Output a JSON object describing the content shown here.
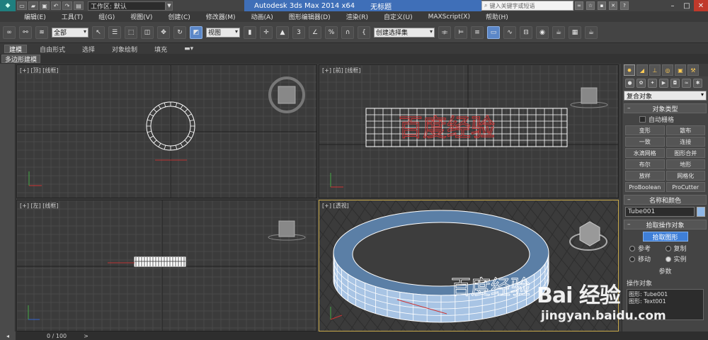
{
  "titlebar": {
    "workspace_label": "工作区: 默认",
    "app_title": "Autodesk 3ds Max  2014 x64",
    "doc_title": "无标题",
    "search_placeholder": "键入关键字或短语"
  },
  "menubar": {
    "items": [
      "编辑(E)",
      "工具(T)",
      "组(G)",
      "视图(V)",
      "创建(C)",
      "修改器(M)",
      "动画(A)",
      "图形编辑器(D)",
      "渲染(R)",
      "自定义(U)",
      "MAXScript(X)",
      "帮助(H)"
    ]
  },
  "toolbar": {
    "selection_filter": "全部",
    "reference_coord": "视图",
    "named_selection": "创建选择集"
  },
  "ribbon": {
    "tabs": [
      "建模",
      "自由形式",
      "选择",
      "对象绘制",
      "填充"
    ],
    "sub_tab": "多边形建模"
  },
  "viewports": {
    "top": "[+] [顶] [线框]",
    "front": "[+] [前] [线框]",
    "left": "[+] [左] [线框]",
    "perspective": "[+] [透视]",
    "front_text": "百度经验",
    "persp_text": "百度经验"
  },
  "command_panel": {
    "category_dropdown": "复合对象",
    "object_type_header": "对象类型",
    "autogrid_label": "自动栅格",
    "buttons": [
      "变形",
      "散布",
      "一致",
      "连接",
      "水滴网格",
      "图形合并",
      "布尔",
      "地形",
      "放样",
      "网格化",
      "ProBoolean",
      "ProCutter"
    ],
    "name_color_header": "名称和颜色",
    "object_name": "Tube001",
    "pick_header": "拾取操作对象",
    "pick_button": "拾取图形",
    "radio_ref": "参考",
    "radio_copy": "复制",
    "radio_move": "移动",
    "radio_instance": "实例",
    "params_header": "参数",
    "operands_label": "操作对象",
    "operands": [
      "图形: Tube001",
      "图形: Text001"
    ]
  },
  "timeline": {
    "counter": "0 / 100",
    "next_label": ">"
  },
  "watermark": {
    "logo_text": "Bai  经验",
    "url": "jingyan.baidu.com"
  }
}
